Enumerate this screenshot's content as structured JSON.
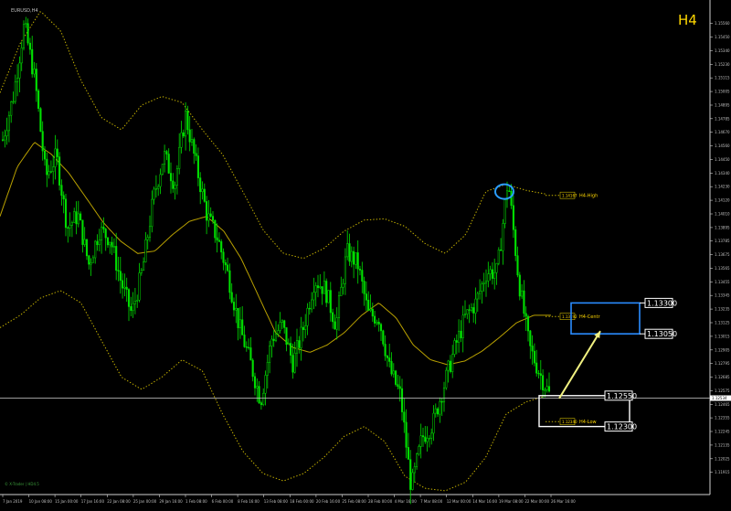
{
  "symbol_label": "EURUSD,H4",
  "timeframe_label": "H4",
  "footer_text": "© X-Trader | HD4.5",
  "colors": {
    "background": "#000000",
    "candle": "#00e000",
    "centre_line": "#b8a000",
    "band": "#c8b400",
    "blue_zone": "#2a8cff",
    "white": "#ffffff",
    "grey_text": "#c0c0c0",
    "gold_label": "#ffd700",
    "arrow": "#f0f080"
  },
  "chart_data": {
    "type": "candlestick",
    "ylim": [
      1.1175,
      1.1575
    ],
    "y_ticks": [
      "1.15560",
      "1.15450",
      "1.15340",
      "1.15230",
      "1.15115",
      "1.15005",
      "1.14895",
      "1.14785",
      "1.14670",
      "1.14560",
      "1.14450",
      "1.14340",
      "1.14230",
      "1.14120",
      "1.14010",
      "1.13895",
      "1.13785",
      "1.13675",
      "1.13565",
      "1.13455",
      "1.13345",
      "1.13235",
      "1.13125",
      "1.13015",
      "1.12905",
      "1.12795",
      "1.12685",
      "1.12575",
      "1.12465",
      "1.12355",
      "1.12245",
      "1.12135",
      "1.12025",
      "1.11915"
    ],
    "x_labels": [
      "7 Jan 2019",
      "10 Jan 08:00",
      "15 Jan 00:00",
      "17 Jan 16:00",
      "22 Jan 08:00",
      "25 Jan 00:00",
      "29 Jan 16:00",
      "1 Feb 08:00",
      "6 Feb 00:00",
      "8 Feb 16:00",
      "13 Feb 08:00",
      "18 Feb 00:00",
      "20 Feb 16:00",
      "25 Feb 08:00",
      "28 Feb 00:00",
      "4 Mar 16:00",
      "7 Mar 08:00",
      "12 Mar 00:00",
      "14 Mar 16:00",
      "19 Mar 08:00",
      "22 Mar 00:00",
      "26 Mar 16:00"
    ],
    "current_price_label": "1.12534",
    "current_price": 1.1253,
    "price_path": [
      1.1462,
      1.1498,
      1.1555,
      1.151,
      1.1432,
      1.1449,
      1.1391,
      1.1401,
      1.1361,
      1.1389,
      1.1382,
      1.1347,
      1.1321,
      1.1357,
      1.1414,
      1.145,
      1.1426,
      1.1482,
      1.1441,
      1.1401,
      1.1382,
      1.1351,
      1.1311,
      1.1283,
      1.1251,
      1.1301,
      1.1312,
      1.1281,
      1.1311,
      1.1349,
      1.1341,
      1.1312,
      1.1371,
      1.1362,
      1.1321,
      1.1318,
      1.1276,
      1.1255,
      1.118,
      1.1221,
      1.1232,
      1.1262,
      1.1292,
      1.1318,
      1.133,
      1.1355,
      1.1355,
      1.143,
      1.1348,
      1.1294,
      1.1272,
      1.1253
    ],
    "centre_path": [
      1.14,
      1.144,
      1.146,
      1.145,
      1.1435,
      1.1415,
      1.1395,
      1.138,
      1.137,
      1.1372,
      1.1385,
      1.1396,
      1.14,
      1.1388,
      1.1366,
      1.1336,
      1.1306,
      1.1294,
      1.129,
      1.1296,
      1.1306,
      1.132,
      1.133,
      1.1318,
      1.1296,
      1.1284,
      1.128,
      1.1283,
      1.1291,
      1.1302,
      1.1314,
      1.132,
      1.132
    ],
    "band_high_path": [
      1.15,
      1.154,
      1.1566,
      1.155,
      1.151,
      1.148,
      1.147,
      1.149,
      1.1497,
      1.1492,
      1.147,
      1.145,
      1.142,
      1.1389,
      1.137,
      1.1366,
      1.1374,
      1.1388,
      1.1397,
      1.1398,
      1.1392,
      1.1378,
      1.137,
      1.1385,
      1.142,
      1.1426,
      1.1421,
      1.1418
    ],
    "band_low_path": [
      1.131,
      1.132,
      1.1334,
      1.134,
      1.133,
      1.13,
      1.127,
      1.126,
      1.127,
      1.1284,
      1.1275,
      1.124,
      1.121,
      1.1192,
      1.1186,
      1.1192,
      1.1205,
      1.1222,
      1.123,
      1.1218,
      1.119,
      1.118,
      1.1178,
      1.1185,
      1.1205,
      1.124,
      1.125,
      1.1255
    ],
    "levels": [
      {
        "name": "H4-High",
        "value": 1.1417,
        "label": "1.14167"
      },
      {
        "name": "H4-Centr",
        "value": 1.1319,
        "label": "1.13192"
      },
      {
        "name": "H4-Low",
        "value": 1.1234,
        "label": "1.12340"
      }
    ],
    "zones": [
      {
        "name": "blue-zone",
        "top": 1.133,
        "bottom": 1.1305,
        "top_label": "1.13300",
        "bottom_label": "1.13050"
      },
      {
        "name": "white-zone",
        "top": 1.1255,
        "bottom": 1.123,
        "top_label": "1.12550",
        "bottom_label": "1.12300"
      }
    ],
    "highlight": {
      "name": "swing-high",
      "value": 1.142
    }
  }
}
